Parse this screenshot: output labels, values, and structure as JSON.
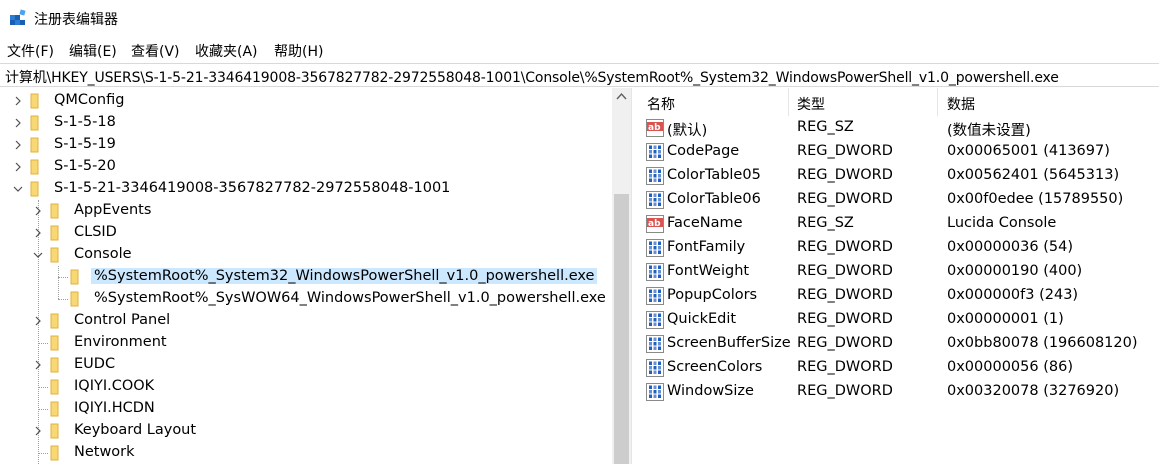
{
  "window": {
    "title": "注册表编辑器"
  },
  "menu": [
    "文件(F)",
    "编辑(E)",
    "查看(V)",
    "收藏夹(A)",
    "帮助(H)"
  ],
  "address": "计算机\\HKEY_USERS\\S-1-5-21-3346419008-3567827782-2972558048-1001\\Console\\%SystemRoot%_System32_WindowsPowerShell_v1.0_powershell.exe",
  "tree": [
    {
      "label": "QMConfig",
      "level": 0,
      "expander": "collapsed"
    },
    {
      "label": "S-1-5-18",
      "level": 0,
      "expander": "collapsed"
    },
    {
      "label": "S-1-5-19",
      "level": 0,
      "expander": "collapsed"
    },
    {
      "label": "S-1-5-20",
      "level": 0,
      "expander": "collapsed"
    },
    {
      "label": "S-1-5-21-3346419008-3567827782-2972558048-1001",
      "level": 0,
      "expander": "expanded"
    },
    {
      "label": "AppEvents",
      "level": 1,
      "expander": "collapsed"
    },
    {
      "label": "CLSID",
      "level": 1,
      "expander": "collapsed"
    },
    {
      "label": "Console",
      "level": 1,
      "expander": "expanded"
    },
    {
      "label": "%SystemRoot%_System32_WindowsPowerShell_v1.0_powershell.exe",
      "level": 2,
      "expander": "none",
      "selected": true
    },
    {
      "label": "%SystemRoot%_SysWOW64_WindowsPowerShell_v1.0_powershell.exe",
      "level": 2,
      "expander": "none"
    },
    {
      "label": "Control Panel",
      "level": 1,
      "expander": "collapsed"
    },
    {
      "label": "Environment",
      "level": 1,
      "expander": "none"
    },
    {
      "label": "EUDC",
      "level": 1,
      "expander": "collapsed"
    },
    {
      "label": "IQIYI.COOK",
      "level": 1,
      "expander": "none"
    },
    {
      "label": "IQIYI.HCDN",
      "level": 1,
      "expander": "none"
    },
    {
      "label": "Keyboard Layout",
      "level": 1,
      "expander": "collapsed"
    },
    {
      "label": "Network",
      "level": 1,
      "expander": "none"
    }
  ],
  "columns": {
    "name": "名称",
    "type": "类型",
    "data": "数据"
  },
  "values": [
    {
      "icon": "string-value-icon",
      "name": "(默认)",
      "type": "REG_SZ",
      "data": "(数值未设置)"
    },
    {
      "icon": "binary-value-icon",
      "name": "CodePage",
      "type": "REG_DWORD",
      "data": "0x00065001 (413697)"
    },
    {
      "icon": "binary-value-icon",
      "name": "ColorTable05",
      "type": "REG_DWORD",
      "data": "0x00562401 (5645313)"
    },
    {
      "icon": "binary-value-icon",
      "name": "ColorTable06",
      "type": "REG_DWORD",
      "data": "0x00f0edee (15789550)"
    },
    {
      "icon": "string-value-icon",
      "name": "FaceName",
      "type": "REG_SZ",
      "data": "Lucida Console"
    },
    {
      "icon": "binary-value-icon",
      "name": "FontFamily",
      "type": "REG_DWORD",
      "data": "0x00000036 (54)"
    },
    {
      "icon": "binary-value-icon",
      "name": "FontWeight",
      "type": "REG_DWORD",
      "data": "0x00000190 (400)"
    },
    {
      "icon": "binary-value-icon",
      "name": "PopupColors",
      "type": "REG_DWORD",
      "data": "0x000000f3 (243)"
    },
    {
      "icon": "binary-value-icon",
      "name": "QuickEdit",
      "type": "REG_DWORD",
      "data": "0x00000001 (1)"
    },
    {
      "icon": "binary-value-icon",
      "name": "ScreenBufferSize",
      "type": "REG_DWORD",
      "data": "0x0bb80078 (196608120)"
    },
    {
      "icon": "binary-value-icon",
      "name": "ScreenColors",
      "type": "REG_DWORD",
      "data": "0x00000056 (86)"
    },
    {
      "icon": "binary-value-icon",
      "name": "WindowSize",
      "type": "REG_DWORD",
      "data": "0x00320078 (3276920)"
    }
  ],
  "colors": {
    "selection": "#cce8ff",
    "folder": "#f8d775",
    "folder_dark": "#e0b13c",
    "accent": "#0078d7"
  }
}
